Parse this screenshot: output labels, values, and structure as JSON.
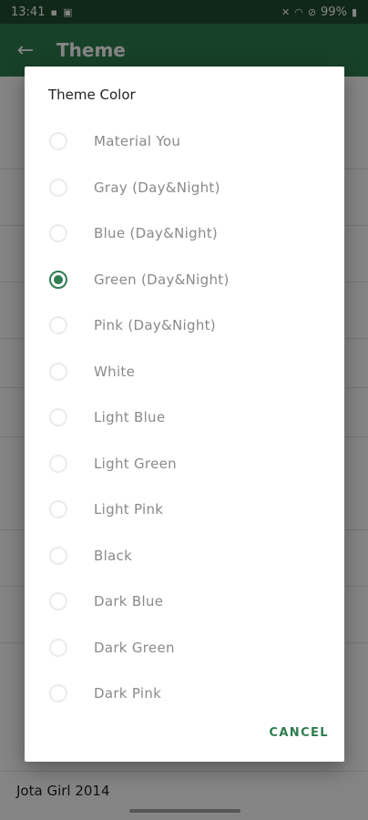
{
  "status_bar": {
    "time": "13:41",
    "battery": "99%"
  },
  "app_bar": {
    "title": "Theme"
  },
  "dialog": {
    "title": "Theme Color",
    "options": [
      {
        "label": "Material You",
        "checked": false
      },
      {
        "label": "Gray (Day&Night)",
        "checked": false
      },
      {
        "label": "Blue (Day&Night)",
        "checked": false
      },
      {
        "label": "Green (Day&Night)",
        "checked": true
      },
      {
        "label": "Pink (Day&Night)",
        "checked": false
      },
      {
        "label": "White",
        "checked": false
      },
      {
        "label": "Light Blue",
        "checked": false
      },
      {
        "label": "Light Green",
        "checked": false
      },
      {
        "label": "Light Pink",
        "checked": false
      },
      {
        "label": "Black",
        "checked": false
      },
      {
        "label": "Dark Blue",
        "checked": false
      },
      {
        "label": "Dark Green",
        "checked": false
      },
      {
        "label": "Dark Pink",
        "checked": false
      }
    ],
    "cancel_label": "CANCEL"
  },
  "background": {
    "last_item": "Jota Girl 2014"
  },
  "colors": {
    "accent": "#2e7d4f",
    "status_bar": "#1f4d2f"
  }
}
